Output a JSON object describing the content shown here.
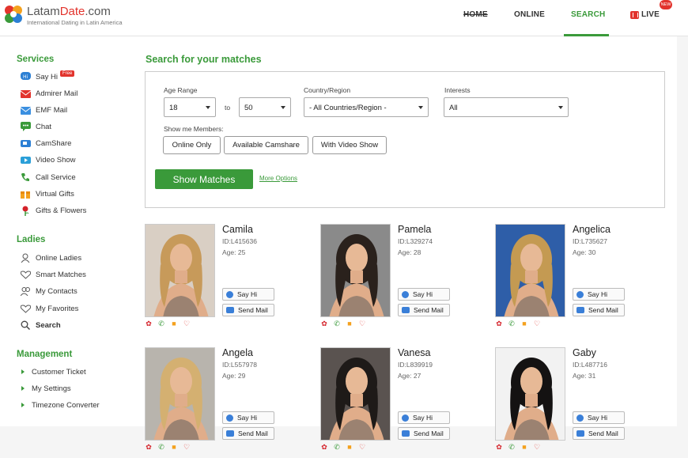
{
  "brand": {
    "name_plain": "Latam",
    "name_red": "Date",
    "suffix": ".com",
    "tagline": "International Dating in Latin America"
  },
  "nav": {
    "home": "HOME",
    "online": "ONLINE",
    "search": "SEARCH",
    "live": "LIVE",
    "new_badge": "NEW"
  },
  "sidebar": {
    "services_title": "Services",
    "services": [
      {
        "label": "Say Hi",
        "icon": "say-hi-icon"
      },
      {
        "label": "Admirer Mail",
        "icon": "admirer-mail-icon"
      },
      {
        "label": "EMF Mail",
        "icon": "emf-mail-icon"
      },
      {
        "label": "Chat",
        "icon": "chat-icon"
      },
      {
        "label": "CamShare",
        "icon": "camshare-icon"
      },
      {
        "label": "Video Show",
        "icon": "video-show-icon"
      },
      {
        "label": "Call Service",
        "icon": "phone-icon"
      },
      {
        "label": "Virtual Gifts",
        "icon": "gift-icon"
      },
      {
        "label": "Gifts & Flowers",
        "icon": "flower-icon"
      }
    ],
    "free_tag": "Free",
    "ladies_title": "Ladies",
    "ladies": [
      {
        "label": "Online Ladies",
        "icon": "person-icon"
      },
      {
        "label": "Smart Matches",
        "icon": "heart-outline-icon"
      },
      {
        "label": "My Contacts",
        "icon": "contacts-icon"
      },
      {
        "label": "My Favorites",
        "icon": "heart-icon"
      },
      {
        "label": "Search",
        "icon": "search-icon"
      }
    ],
    "management_title": "Management",
    "management": [
      {
        "label": "Customer Ticket"
      },
      {
        "label": "My Settings"
      },
      {
        "label": "Timezone Converter"
      }
    ]
  },
  "search": {
    "title": "Search for your matches",
    "age_range_label": "Age Range",
    "age_from": "18",
    "to_label": "to",
    "age_to": "50",
    "country_label": "Country/Region",
    "country_value": "- All Countries/Region -",
    "interests_label": "Interests",
    "interests_value": "All",
    "show_members_label": "Show me Members:",
    "options": [
      "Online Only",
      "Available Camshare",
      "With Video Show"
    ],
    "show_matches": "Show Matches",
    "more_options": "More Options"
  },
  "profiles": [
    {
      "name": "Camila",
      "id": "ID:L415636",
      "age": "Age: 25",
      "hair": "#c79a5a",
      "bg": "#d9cfc4"
    },
    {
      "name": "Pamela",
      "id": "ID:L329274",
      "age": "Age: 28",
      "hair": "#2a211c",
      "bg": "#8a8a8a"
    },
    {
      "name": "Angelica",
      "id": "ID:L735627",
      "age": "Age: 30",
      "hair": "#c49a52",
      "bg": "#2e5ea8"
    },
    {
      "name": "Angela",
      "id": "ID:L557978",
      "age": "Age: 29",
      "hair": "#d4b071",
      "bg": "#b8b4ad"
    },
    {
      "name": "Vanesa",
      "id": "ID:L839919",
      "age": "Age: 27",
      "hair": "#1e1a18",
      "bg": "#5a5350"
    },
    {
      "name": "Gaby",
      "id": "ID:L487716",
      "age": "Age: 31",
      "hair": "#141212",
      "bg": "#f2f2f2"
    }
  ],
  "card_buttons": {
    "say_hi": "Say Hi",
    "send_mail": "Send Mail"
  },
  "colors": {
    "brand_green": "#3a9a3a",
    "brand_red": "#e2342d"
  }
}
